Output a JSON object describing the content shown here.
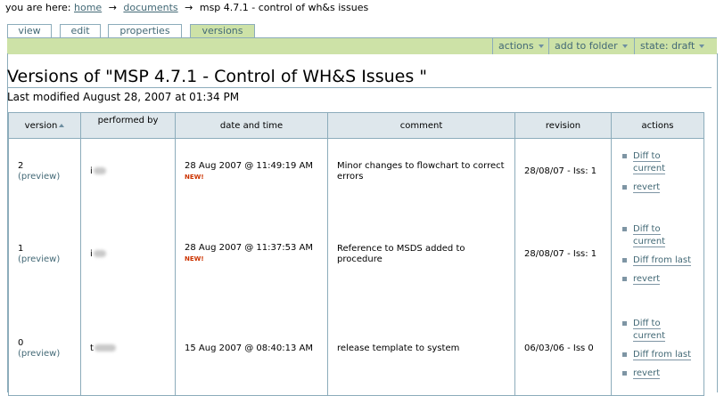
{
  "breadcrumb": {
    "prefix": "you are here:",
    "home": "home",
    "documents": "documents",
    "current": "msp 4.7.1 - control of wh&s issues",
    "separator": "→"
  },
  "tabs": [
    {
      "label": "view"
    },
    {
      "label": "edit"
    },
    {
      "label": "properties"
    },
    {
      "label": "versions",
      "selected": true
    }
  ],
  "actionbar": {
    "actions": "actions",
    "add_to_folder": "add to folder",
    "state": "state: draft"
  },
  "page": {
    "title": "Versions of \"MSP 4.7.1 - Control of WH&S Issues \"",
    "last_modified": "Last modified August 28, 2007 at 01:34 PM"
  },
  "table": {
    "headers": {
      "version": "version",
      "performed_by": "performed by",
      "date_time": "date and time",
      "comment": "comment",
      "revision": "revision",
      "actions": "actions"
    },
    "rows": [
      {
        "version": "2",
        "preview": "(preview)",
        "performer_initial": "i",
        "date": "28 Aug 2007 @ 11:49:19 AM",
        "new_badge": "NEW!",
        "comment": "Minor changes to flowchart to correct errors",
        "revision": "28/08/07 - Iss: 1",
        "actions": [
          "Diff to current",
          "revert"
        ]
      },
      {
        "version": "1",
        "preview": "(preview)",
        "performer_initial": "i",
        "date": "28 Aug 2007 @ 11:37:53 AM",
        "new_badge": "NEW!",
        "comment": "Reference to MSDS added to procedure",
        "revision": "28/08/07 - Iss: 1",
        "actions": [
          "Diff to current",
          "Diff from last",
          "revert"
        ]
      },
      {
        "version": "0",
        "preview": "(preview)",
        "performer_initial": "t",
        "date": "15 Aug 2007 @ 08:40:13 AM",
        "new_badge": "",
        "comment": "release template to system",
        "revision": "06/03/06 - Iss 0",
        "actions": [
          "Diff to current",
          "Diff from last",
          "revert"
        ]
      }
    ]
  },
  "colors": {
    "accent_green": "#cde2a7",
    "border_blue": "#8cacbb",
    "link": "#436976",
    "header_bg": "#dee7ec",
    "new_badge": "#cc3300"
  }
}
